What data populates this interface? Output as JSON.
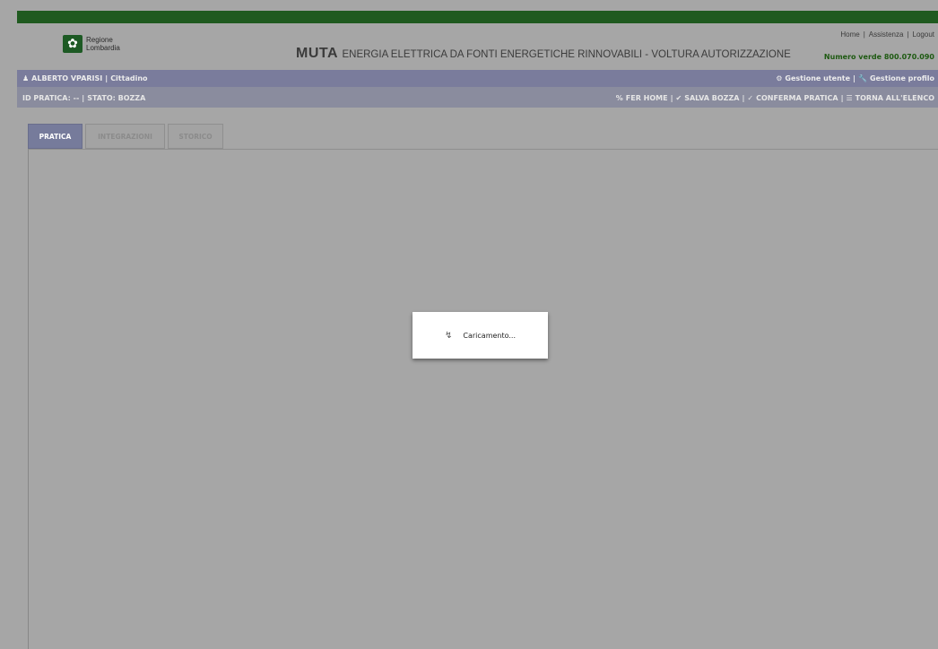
{
  "header": {
    "logo_line1": "Regione",
    "logo_line2": "Lombardia",
    "title_main": "MUTA",
    "title_sub": "ENERGIA ELETTRICA DA FONTI ENERGETICHE RINNOVABILI - VOLTURA AUTORIZZAZIONE",
    "links": [
      "Home",
      "Assistenza",
      "Logout"
    ],
    "phone": "Numero verde 800.070.090"
  },
  "userbar": {
    "user": "ALBERTO VPARISI",
    "role": "Cittadino",
    "gestione_utente": "Gestione utente",
    "gestione_profilo": "Gestione profilo"
  },
  "statusbar": {
    "id_pratica": "ID PRATICA: --",
    "stato": "STATO: BOZZA",
    "actions": [
      "FER HOME",
      "SALVA BOZZA",
      "CONFERMA PRATICA",
      "TORNA ALL'ELENCO"
    ]
  },
  "tabs": [
    "PRATICA",
    "INTEGRAZIONI",
    "STORICO"
  ],
  "loading": {
    "text": "Caricamento..."
  },
  "icons": {
    "user": "user-icon",
    "gear": "gear-icon",
    "wrench": "wrench-icon",
    "home": "link-icon",
    "save": "save-icon",
    "check": "check-icon",
    "list": "list-icon",
    "spinner": "spinner-icon"
  },
  "colors": {
    "topbar": "#1f5a1f",
    "userbar": "#7a7c9c",
    "statusbar": "#8a8c9e",
    "active_tab": "#767b9b",
    "overlay": "#a6a6a6",
    "phone": "#1e5a12"
  }
}
